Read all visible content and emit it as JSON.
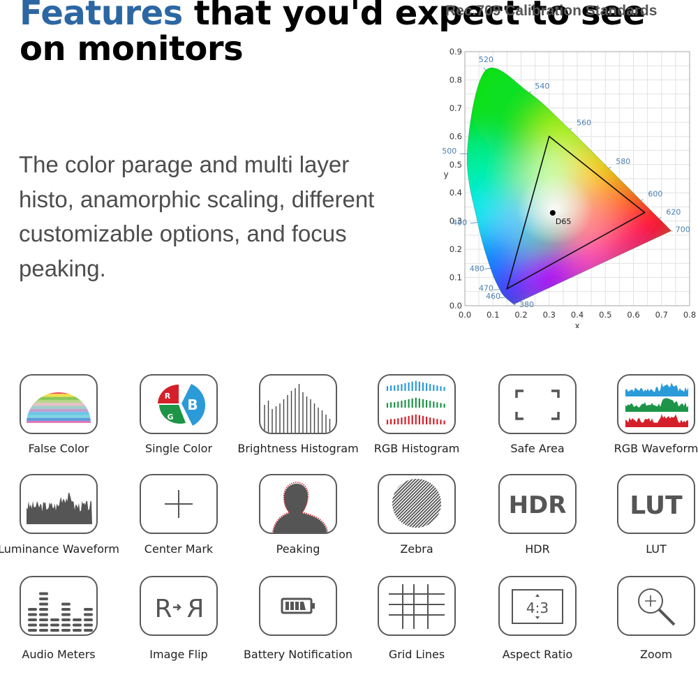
{
  "headline": {
    "accent": "Features",
    "rest": " that you'd expect to see on monitors"
  },
  "description": "The color parage and multi layer histo, anamorphic scaling, different customizable options, and focus peaking.",
  "chart_title": "Rec.709 Calibration Standards",
  "colors": {
    "accent": "#2c67a3",
    "tile_border": "#5a5a5a",
    "icon_gray": "#555555",
    "rgb_red": "#d4202a",
    "rgb_green": "#1d9447",
    "rgb_blue": "#2b9ad9",
    "wavelength_label": "#4a7fb0"
  },
  "features": [
    {
      "label": "False Color",
      "icon": "false-color-icon"
    },
    {
      "label": "Single Color",
      "icon": "single-color-rgb-icon"
    },
    {
      "label": "Brightness Histogram",
      "icon": "brightness-histogram-icon"
    },
    {
      "label": "RGB Histogram",
      "icon": "rgb-histogram-icon"
    },
    {
      "label": "Safe Area",
      "icon": "safe-area-icon"
    },
    {
      "label": "RGB Waveform",
      "icon": "rgb-waveform-icon"
    },
    {
      "label": "Luminance Waveform",
      "icon": "luminance-waveform-icon"
    },
    {
      "label": "Center Mark",
      "icon": "center-mark-icon"
    },
    {
      "label": "Peaking",
      "icon": "peaking-icon"
    },
    {
      "label": "Zebra",
      "icon": "zebra-icon"
    },
    {
      "label": "HDR",
      "icon": "hdr-icon",
      "icon_text": "HDR"
    },
    {
      "label": "LUT",
      "icon": "lut-icon",
      "icon_text": "LUT"
    },
    {
      "label": "Audio Meters",
      "icon": "audio-meters-icon"
    },
    {
      "label": "Image Flip",
      "icon": "image-flip-icon",
      "icon_text": "R"
    },
    {
      "label": "Battery Notification",
      "icon": "battery-icon"
    },
    {
      "label": "Grid Lines",
      "icon": "grid-lines-icon"
    },
    {
      "label": "Aspect Ratio",
      "icon": "aspect-ratio-icon",
      "icon_text": "4:3"
    },
    {
      "label": "Zoom",
      "icon": "zoom-icon"
    }
  ],
  "chart_data": {
    "type": "scatter",
    "title": "Rec.709 Calibration Standards",
    "xlabel": "x",
    "ylabel": "y",
    "xlim": [
      0.0,
      0.8
    ],
    "ylim": [
      0.0,
      0.9
    ],
    "xticks": [
      "0.0",
      "0.1",
      "0.2",
      "0.3",
      "0.4",
      "0.5",
      "0.6",
      "0.7",
      "0.8"
    ],
    "yticks": [
      "0.0",
      "0.1",
      "0.2",
      "0.3",
      "0.4",
      "0.5",
      "0.6",
      "0.7",
      "0.8",
      "0.9"
    ],
    "grid": true,
    "spectral_locus": [
      {
        "nm": 380,
        "x": 0.1741,
        "y": 0.005
      },
      {
        "nm": 460,
        "x": 0.144,
        "y": 0.0297
      },
      {
        "nm": 470,
        "x": 0.1241,
        "y": 0.0578
      },
      {
        "nm": 480,
        "x": 0.0913,
        "y": 0.1327
      },
      {
        "nm": 490,
        "x": 0.0454,
        "y": 0.295
      },
      {
        "nm": 500,
        "x": 0.0082,
        "y": 0.5384
      },
      {
        "nm": 520,
        "x": 0.0743,
        "y": 0.8338
      },
      {
        "nm": 540,
        "x": 0.2296,
        "y": 0.7543
      },
      {
        "nm": 560,
        "x": 0.3731,
        "y": 0.6245
      },
      {
        "nm": 580,
        "x": 0.5125,
        "y": 0.4866
      },
      {
        "nm": 600,
        "x": 0.627,
        "y": 0.3725
      },
      {
        "nm": 620,
        "x": 0.6915,
        "y": 0.3083
      },
      {
        "nm": 700,
        "x": 0.7347,
        "y": 0.2653
      }
    ],
    "wavelength_labels": [
      "380",
      "460",
      "470",
      "480",
      "490",
      "500",
      "520",
      "540",
      "560",
      "580",
      "600",
      "620",
      "700"
    ],
    "gamut_triangle": {
      "name": "Rec.709",
      "red": {
        "x": 0.64,
        "y": 0.33
      },
      "green": {
        "x": 0.3,
        "y": 0.6
      },
      "blue": {
        "x": 0.15,
        "y": 0.06
      }
    },
    "white_point": {
      "name": "D65",
      "x": 0.3127,
      "y": 0.329
    }
  }
}
